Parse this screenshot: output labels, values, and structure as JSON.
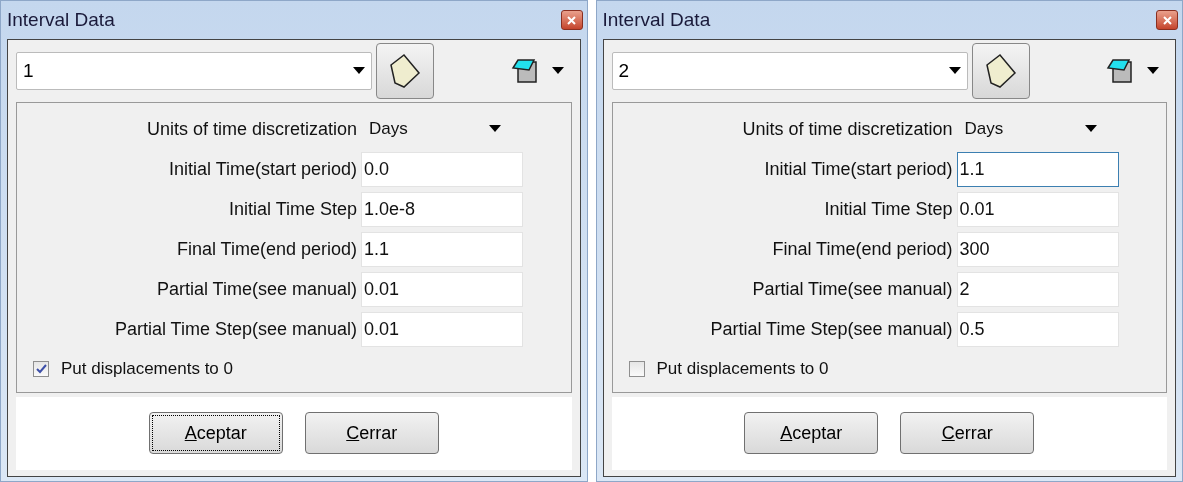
{
  "dialogs": [
    {
      "title": "Interval Data",
      "interval": "1",
      "units_label": "Units of time discretization",
      "units_value": "Days",
      "fields": [
        {
          "label": "Initial Time(start period)",
          "value": "0.0",
          "focused": false
        },
        {
          "label": "Initial Time Step",
          "value": "1.0e-8",
          "focused": false
        },
        {
          "label": "Final Time(end period)",
          "value": "1.1",
          "focused": false
        },
        {
          "label": "Partial Time(see manual)",
          "value": "0.01",
          "focused": false
        },
        {
          "label": "Partial Time Step(see manual)",
          "value": "0.01",
          "focused": false
        }
      ],
      "checkbox": {
        "label": "Put displacements to 0",
        "checked": true
      },
      "buttons": [
        {
          "label": "Aceptar",
          "focused": true
        },
        {
          "label": "Cerrar",
          "focused": false
        }
      ]
    },
    {
      "title": "Interval Data",
      "interval": "2",
      "units_label": "Units of time discretization",
      "units_value": "Days",
      "fields": [
        {
          "label": "Initial Time(start period)",
          "value": "1.1",
          "focused": true
        },
        {
          "label": "Initial Time Step",
          "value": "0.01",
          "focused": false
        },
        {
          "label": "Final Time(end period)",
          "value": "300",
          "focused": false
        },
        {
          "label": "Partial Time(see manual)",
          "value": "2",
          "focused": false
        },
        {
          "label": "Partial Time Step(see manual)",
          "value": "0.5",
          "focused": false
        }
      ],
      "checkbox": {
        "label": "Put displacements to 0",
        "checked": false
      },
      "buttons": [
        {
          "label": "Aceptar",
          "focused": false
        },
        {
          "label": "Cerrar",
          "focused": false
        }
      ]
    }
  ]
}
